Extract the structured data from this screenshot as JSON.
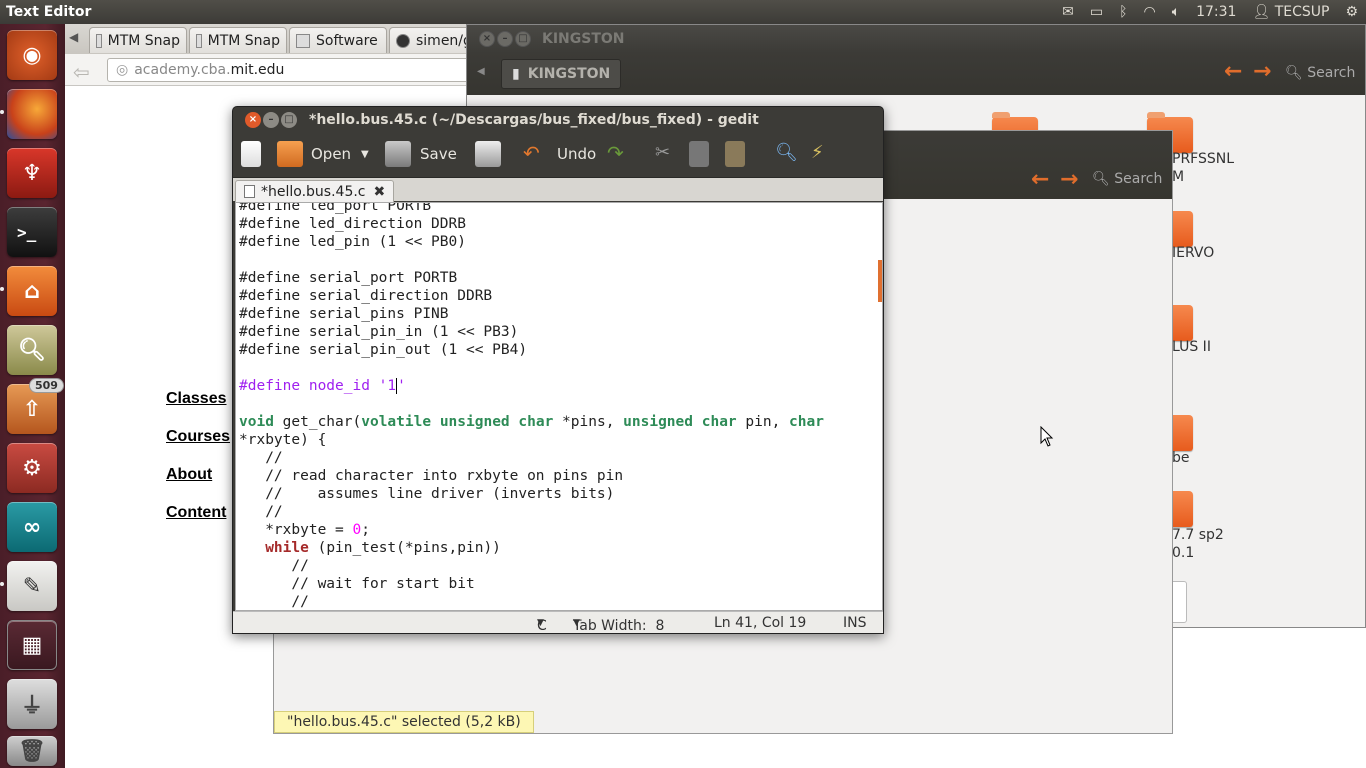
{
  "topbar": {
    "app_title": "Text Editor",
    "clock": "17:31",
    "user": "TECSUP",
    "indicators": [
      "mail-icon",
      "battery-icon",
      "bluetooth-icon",
      "wifi-icon",
      "volume-icon",
      "user-icon",
      "gear-icon"
    ]
  },
  "launcher": {
    "items": [
      "ubuntu-dash-icon",
      "firefox-icon",
      "red-app-icon",
      "terminal-icon",
      "home-folder-icon",
      "image-viewer-icon",
      "software-updater-icon",
      "system-settings-icon",
      "arduino-icon",
      "text-editor-icon",
      "workspace-switcher-icon",
      "usb-drive-icon",
      "trash-icon"
    ],
    "updater_badge": "509"
  },
  "browser": {
    "tabs": [
      "MTM Snap",
      "MTM Snap",
      "Software",
      "simen/g"
    ],
    "url_prefix": "academy.cba.",
    "url_domain": "mit.edu",
    "links": [
      "Classes",
      "Courses",
      "About",
      "Content"
    ]
  },
  "nautilus_back": {
    "title": "KINGSTON",
    "path_button": "KINGSTON",
    "search_label": "Search",
    "folder_labels": [
      "PRFSSNL",
      "M",
      "IERVO",
      "LUS II",
      "be",
      "7.7 sp2",
      "0.1"
    ]
  },
  "nautilus_front": {
    "search_label": "Search",
    "status": "\"hello.bus.45.c\" selected (5,2 kB)"
  },
  "gedit": {
    "title": "*hello.bus.45.c (~/Descargas/bus_fixed/bus_fixed) - gedit",
    "toolbar": {
      "open": "Open",
      "save": "Save",
      "undo": "Undo"
    },
    "tab_label": "*hello.bus.45.c",
    "status": {
      "language": "C",
      "tab_width": "Tab Width:  8",
      "position": "Ln 41, Col 19",
      "mode": "INS"
    }
  }
}
